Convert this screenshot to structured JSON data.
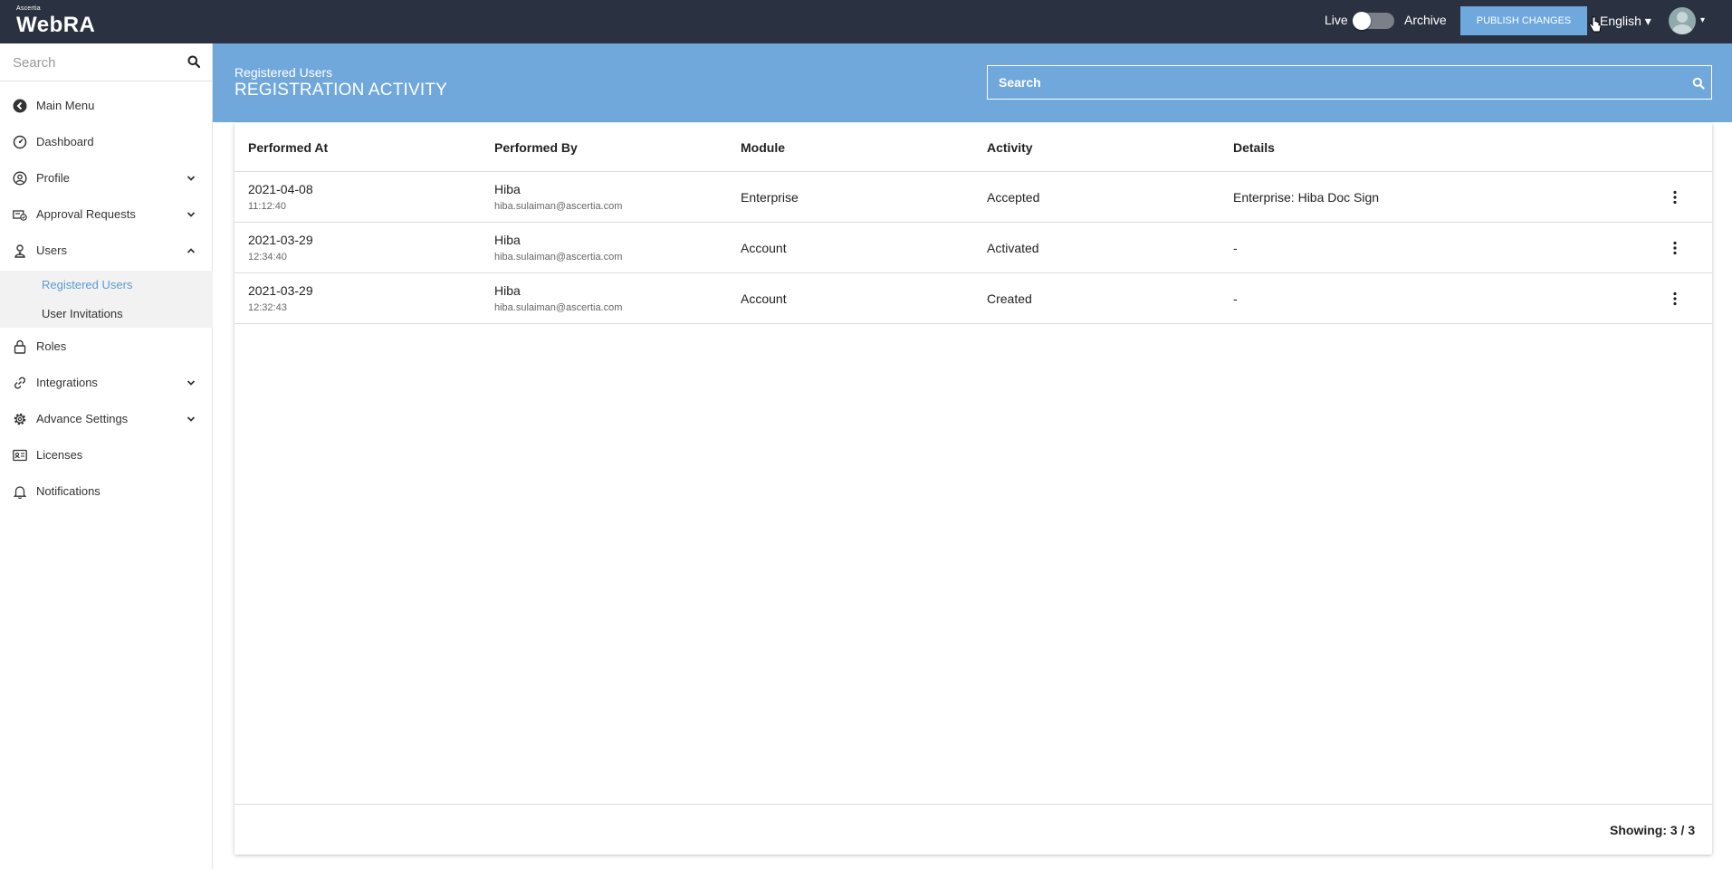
{
  "header": {
    "brand": "Ascertia",
    "app_name": "WebRA",
    "live_label": "Live",
    "archive_label": "Archive",
    "publish_label": "PUBLISH CHANGES",
    "language": "English ▾",
    "avatar_caret": "▾"
  },
  "sidebar": {
    "search_placeholder": "Search",
    "items": [
      {
        "label": "Main Menu",
        "icon": "back-circle-icon"
      },
      {
        "label": "Dashboard",
        "icon": "dashboard-gauge-icon"
      },
      {
        "label": "Profile",
        "icon": "profile-icon",
        "expandable": true
      },
      {
        "label": "Approval Requests",
        "icon": "approval-icon",
        "expandable": true
      },
      {
        "label": "Users",
        "icon": "users-icon",
        "expanded": true
      },
      {
        "label": "Roles",
        "icon": "lock-icon"
      },
      {
        "label": "Integrations",
        "icon": "link-icon",
        "expandable": true
      },
      {
        "label": "Advance Settings",
        "icon": "gear-icon",
        "expandable": true
      },
      {
        "label": "Licenses",
        "icon": "license-card-icon"
      },
      {
        "label": "Notifications",
        "icon": "bell-icon"
      }
    ],
    "users_subitems": [
      {
        "label": "Registered Users",
        "active": true
      },
      {
        "label": "User Invitations",
        "active": false
      }
    ]
  },
  "main": {
    "breadcrumb": "Registered Users",
    "title": "REGISTRATION ACTIVITY",
    "search_placeholder": "Search",
    "columns": [
      "Performed At",
      "Performed By",
      "Module",
      "Activity",
      "Details"
    ],
    "rows": [
      {
        "date": "2021-04-08",
        "time": "11:12:40",
        "name": "Hiba",
        "email": "hiba.sulaiman@ascertia.com",
        "module": "Enterprise",
        "activity": "Accepted",
        "details": "Enterprise: Hiba Doc Sign"
      },
      {
        "date": "2021-03-29",
        "time": "12:34:40",
        "name": "Hiba",
        "email": "hiba.sulaiman@ascertia.com",
        "module": "Account",
        "activity": "Activated",
        "details": "-"
      },
      {
        "date": "2021-03-29",
        "time": "12:32:43",
        "name": "Hiba",
        "email": "hiba.sulaiman@ascertia.com",
        "module": "Account",
        "activity": "Created",
        "details": "-"
      }
    ],
    "showing": "Showing:  3 / 3"
  },
  "colors": {
    "topbar": "#2a3140",
    "accent": "#70a8dc",
    "publish_button": "#6fa8dc",
    "active_subitem": "#5b9bd5"
  }
}
